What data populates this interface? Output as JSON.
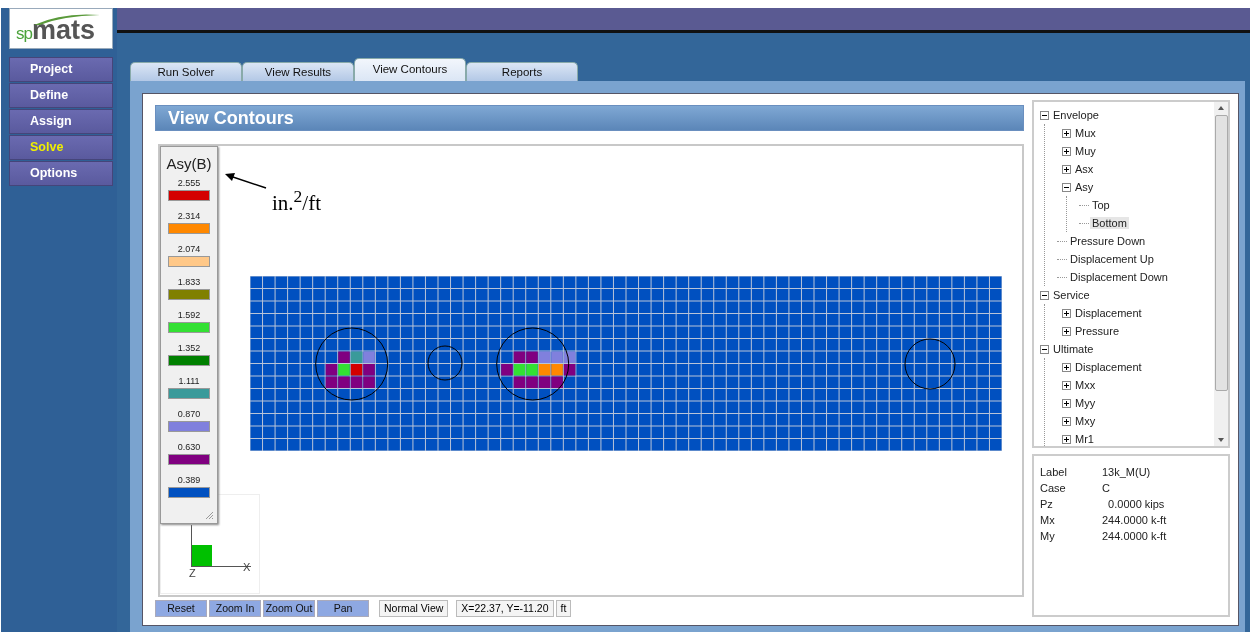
{
  "logo": {
    "prefix": "sp",
    "name": "mats"
  },
  "menu": [
    {
      "label": "Project",
      "selected": false
    },
    {
      "label": "Define",
      "selected": false
    },
    {
      "label": "Assign",
      "selected": false
    },
    {
      "label": "Solve",
      "selected": true
    },
    {
      "label": "Options",
      "selected": false
    }
  ],
  "tabs": [
    {
      "label": "Run Solver",
      "selected": false
    },
    {
      "label": "View Results",
      "selected": false
    },
    {
      "label": "View Contours",
      "selected": true
    },
    {
      "label": "Reports",
      "selected": false
    }
  ],
  "panel_title": "View Contours",
  "legend": {
    "title": "Asy(B)",
    "unit_note": {
      "base": "in.",
      "sup": "2",
      "rest": "/ft"
    },
    "items": [
      {
        "value": "2.555",
        "color": "#d40000"
      },
      {
        "value": "2.314",
        "color": "#ff8800"
      },
      {
        "value": "2.074",
        "color": "#ffc888"
      },
      {
        "value": "1.833",
        "color": "#808000"
      },
      {
        "value": "1.592",
        "color": "#33e033"
      },
      {
        "value": "1.352",
        "color": "#008000"
      },
      {
        "value": "1.111",
        "color": "#3a9a9a"
      },
      {
        "value": "0.870",
        "color": "#8080dd"
      },
      {
        "value": "0.630",
        "color": "#800080"
      },
      {
        "value": "0.389",
        "color": "#0050c0"
      }
    ]
  },
  "axes": {
    "vertical": "Z",
    "horizontal": "X"
  },
  "tree": {
    "items": [
      {
        "label": "Envelope",
        "expanded": true,
        "selected": false,
        "children": [
          {
            "label": "Mux",
            "expanded": false,
            "selected": false
          },
          {
            "label": "Muy",
            "expanded": false,
            "selected": false
          },
          {
            "label": "Asx",
            "expanded": false,
            "selected": false
          },
          {
            "label": "Asy",
            "expanded": true,
            "selected": false,
            "children": [
              {
                "label": "Top",
                "selected": false
              },
              {
                "label": "Bottom",
                "selected": true
              }
            ]
          },
          {
            "label": "Pressure Down",
            "selected": false
          },
          {
            "label": "Displacement Up",
            "selected": false
          },
          {
            "label": "Displacement Down",
            "selected": false
          }
        ]
      },
      {
        "label": "Service",
        "expanded": true,
        "selected": false,
        "children": [
          {
            "label": "Displacement",
            "expanded": false,
            "selected": false
          },
          {
            "label": "Pressure",
            "expanded": false,
            "selected": false
          }
        ]
      },
      {
        "label": "Ultimate",
        "expanded": true,
        "selected": false,
        "children": [
          {
            "label": "Displacement",
            "expanded": false,
            "selected": false
          },
          {
            "label": "Mxx",
            "expanded": false,
            "selected": false
          },
          {
            "label": "Myy",
            "expanded": false,
            "selected": false
          },
          {
            "label": "Mxy",
            "expanded": false,
            "selected": false
          },
          {
            "label": "Mr1",
            "expanded": false,
            "selected": false
          }
        ]
      }
    ]
  },
  "info": [
    {
      "label": "Label",
      "value": "13k_M(U)"
    },
    {
      "label": "Case",
      "value": "C"
    },
    {
      "label": "Pz",
      "value": "  0.0000 kips"
    },
    {
      "label": "Mx",
      "value": "244.0000 k-ft"
    },
    {
      "label": "My",
      "value": "244.0000 k-ft"
    }
  ],
  "view_buttons": [
    "Reset",
    "Zoom In",
    "Zoom Out",
    "Pan"
  ],
  "status": {
    "view": "Normal View",
    "coords": "X=22.37, Y=-11.20",
    "unit": "ft"
  }
}
